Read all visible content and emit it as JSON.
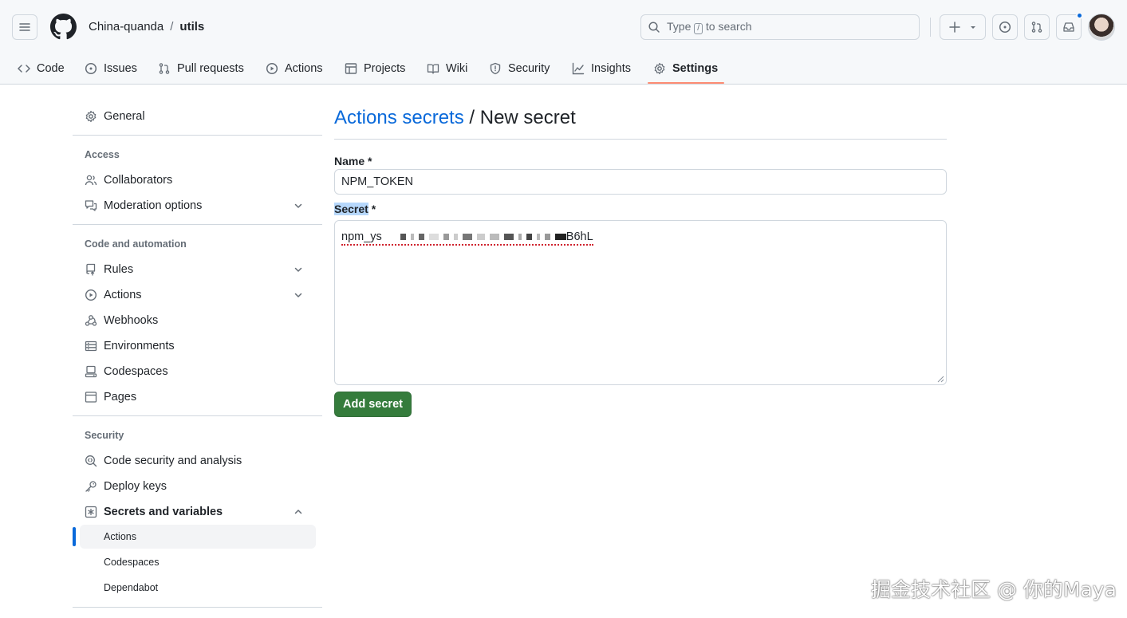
{
  "header": {
    "owner": "China-quanda",
    "separator": "/",
    "repo": "utils",
    "search": {
      "prefix": "Type",
      "key": "/",
      "suffix": "to search"
    }
  },
  "tabs": [
    {
      "label": "Code",
      "icon": "code-icon"
    },
    {
      "label": "Issues",
      "icon": "issue-opened-icon"
    },
    {
      "label": "Pull requests",
      "icon": "git-pull-request-icon"
    },
    {
      "label": "Actions",
      "icon": "play-icon"
    },
    {
      "label": "Projects",
      "icon": "table-icon"
    },
    {
      "label": "Wiki",
      "icon": "book-icon"
    },
    {
      "label": "Security",
      "icon": "shield-icon"
    },
    {
      "label": "Insights",
      "icon": "graph-icon"
    },
    {
      "label": "Settings",
      "icon": "gear-icon",
      "selected": true
    }
  ],
  "sidebar": {
    "general": "General",
    "access_heading": "Access",
    "collaborators": "Collaborators",
    "moderation": "Moderation options",
    "code_heading": "Code and automation",
    "rules": "Rules",
    "actions": "Actions",
    "webhooks": "Webhooks",
    "environments": "Environments",
    "codespaces": "Codespaces",
    "pages": "Pages",
    "security_heading": "Security",
    "code_security": "Code security and analysis",
    "deploy_keys": "Deploy keys",
    "secrets_variables": "Secrets and variables",
    "sub_actions": "Actions",
    "sub_codespaces": "Codespaces",
    "sub_dependabot": "Dependabot"
  },
  "main": {
    "breadcrumb_link": "Actions secrets",
    "breadcrumb_sep": " / ",
    "breadcrumb_current": "New secret",
    "name_label": "Name",
    "required_mark": "*",
    "name_value": "NPM_TOKEN",
    "secret_label": "Secret",
    "secret_start": "npm_ys",
    "secret_end": "B6hL",
    "add_button": "Add secret"
  },
  "watermark": "掘金技术社区 @ 你的Maya",
  "colors": {
    "accent_link": "#0969da",
    "button_green": "#357c3c",
    "tab_underline": "#fd8c73"
  }
}
